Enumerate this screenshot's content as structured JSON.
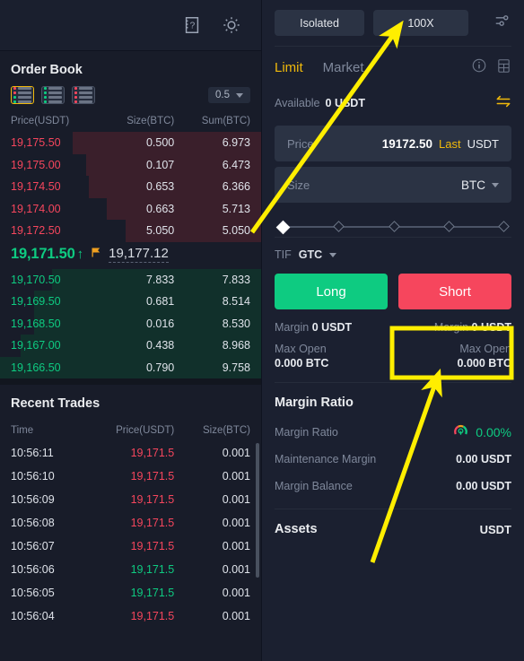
{
  "left_header": {
    "help_icon": "manual-book-question-icon",
    "theme_icon": "sun-icon"
  },
  "order_book": {
    "title": "Order Book",
    "view_modes": [
      {
        "name": "both-icon",
        "active": true
      },
      {
        "name": "bids-only-icon",
        "active": false
      },
      {
        "name": "asks-only-icon",
        "active": false
      }
    ],
    "grouping": "0.5",
    "columns": [
      "Price(USDT)",
      "Size(BTC)",
      "Sum(BTC)"
    ],
    "asks": [
      {
        "price": "19,175.50",
        "size": "0.500",
        "sum": "6.973",
        "depth": 72
      },
      {
        "price": "19,175.00",
        "size": "0.107",
        "sum": "6.473",
        "depth": 67
      },
      {
        "price": "19,174.50",
        "size": "0.653",
        "sum": "6.366",
        "depth": 66
      },
      {
        "price": "19,174.00",
        "size": "0.663",
        "sum": "5.713",
        "depth": 59
      },
      {
        "price": "19,172.50",
        "size": "5.050",
        "sum": "5.050",
        "depth": 52
      }
    ],
    "spread": {
      "last_price": "19,171.50",
      "direction_arrow": "↑",
      "flag_icon": "flag-icon",
      "index_price": "19,177.12"
    },
    "bids": [
      {
        "price": "19,170.50",
        "size": "7.833",
        "sum": "7.833",
        "depth": 80
      },
      {
        "price": "19,169.50",
        "size": "0.681",
        "sum": "8.514",
        "depth": 87
      },
      {
        "price": "19,168.50",
        "size": "0.016",
        "sum": "8.530",
        "depth": 87
      },
      {
        "price": "19,167.00",
        "size": "0.438",
        "sum": "8.968",
        "depth": 92
      },
      {
        "price": "19,166.50",
        "size": "0.790",
        "sum": "9.758",
        "depth": 100
      }
    ]
  },
  "recent_trades": {
    "title": "Recent Trades",
    "columns": [
      "Time",
      "Price(USDT)",
      "Size(BTC)"
    ],
    "rows": [
      {
        "time": "10:56:11",
        "price": "19,171.5",
        "size": "0.001",
        "side": "sell"
      },
      {
        "time": "10:56:10",
        "price": "19,171.5",
        "size": "0.001",
        "side": "sell"
      },
      {
        "time": "10:56:09",
        "price": "19,171.5",
        "size": "0.001",
        "side": "sell"
      },
      {
        "time": "10:56:08",
        "price": "19,171.5",
        "size": "0.001",
        "side": "sell"
      },
      {
        "time": "10:56:07",
        "price": "19,171.5",
        "size": "0.001",
        "side": "sell"
      },
      {
        "time": "10:56:06",
        "price": "19,171.5",
        "size": "0.001",
        "side": "buy"
      },
      {
        "time": "10:56:05",
        "price": "19,171.5",
        "size": "0.001",
        "side": "buy"
      },
      {
        "time": "10:56:04",
        "price": "19,171.5",
        "size": "0.001",
        "side": "sell"
      }
    ]
  },
  "trade_panel": {
    "margin_mode": "Isolated",
    "leverage": "100X",
    "settings_icon": "sliders-settings-icon",
    "tabs": [
      {
        "label": "Limit",
        "active": true
      },
      {
        "label": "Market",
        "active": false
      }
    ],
    "info_icon": "info-circle-icon",
    "calculator_icon": "calculator-icon",
    "available_label": "Available",
    "available_value": "0 USDT",
    "transfer_icon": "transfer-arrows-icon",
    "price_field": {
      "placeholder": "Price",
      "value": "19172.50",
      "last_label": "Last",
      "unit": "USDT"
    },
    "size_field": {
      "placeholder": "Size",
      "unit": "BTC"
    },
    "slider": {
      "nodes": 5,
      "filled_index": 0
    },
    "tif_label": "TIF",
    "tif_value": "GTC",
    "long_button": "Long",
    "short_button": "Short",
    "long_margin_label": "Margin",
    "long_margin_value": "0 USDT",
    "short_margin_label": "Margin",
    "short_margin_value": "0 USDT",
    "long_maxopen_label": "Max Open",
    "long_maxopen_value": "0.000 BTC",
    "short_maxopen_label": "Max Open",
    "short_maxopen_value": "0.000 BTC"
  },
  "margin_ratio": {
    "title": "Margin Ratio",
    "rows": [
      {
        "label": "Margin Ratio",
        "value": "0.00%",
        "gauge_icon": "gauge-icon",
        "green": true
      },
      {
        "label": "Maintenance Margin",
        "value": "0.00 USDT",
        "green": false
      },
      {
        "label": "Margin Balance",
        "value": "0.00 USDT",
        "green": false
      }
    ]
  },
  "assets": {
    "title": "Assets",
    "currency": "USDT"
  },
  "annotations": {
    "highlight_color": "#ffee00",
    "arrow_to_leverage": "arrow-pointing-to-leverage",
    "arrow_to_short": "arrow-pointing-to-short-button",
    "highlight_box": "short-button-highlight"
  },
  "colors": {
    "ask_red": "#f6465d",
    "bid_green": "#0ecb81",
    "accent_yellow": "#f0b90b",
    "annotation": "#ffee00"
  }
}
